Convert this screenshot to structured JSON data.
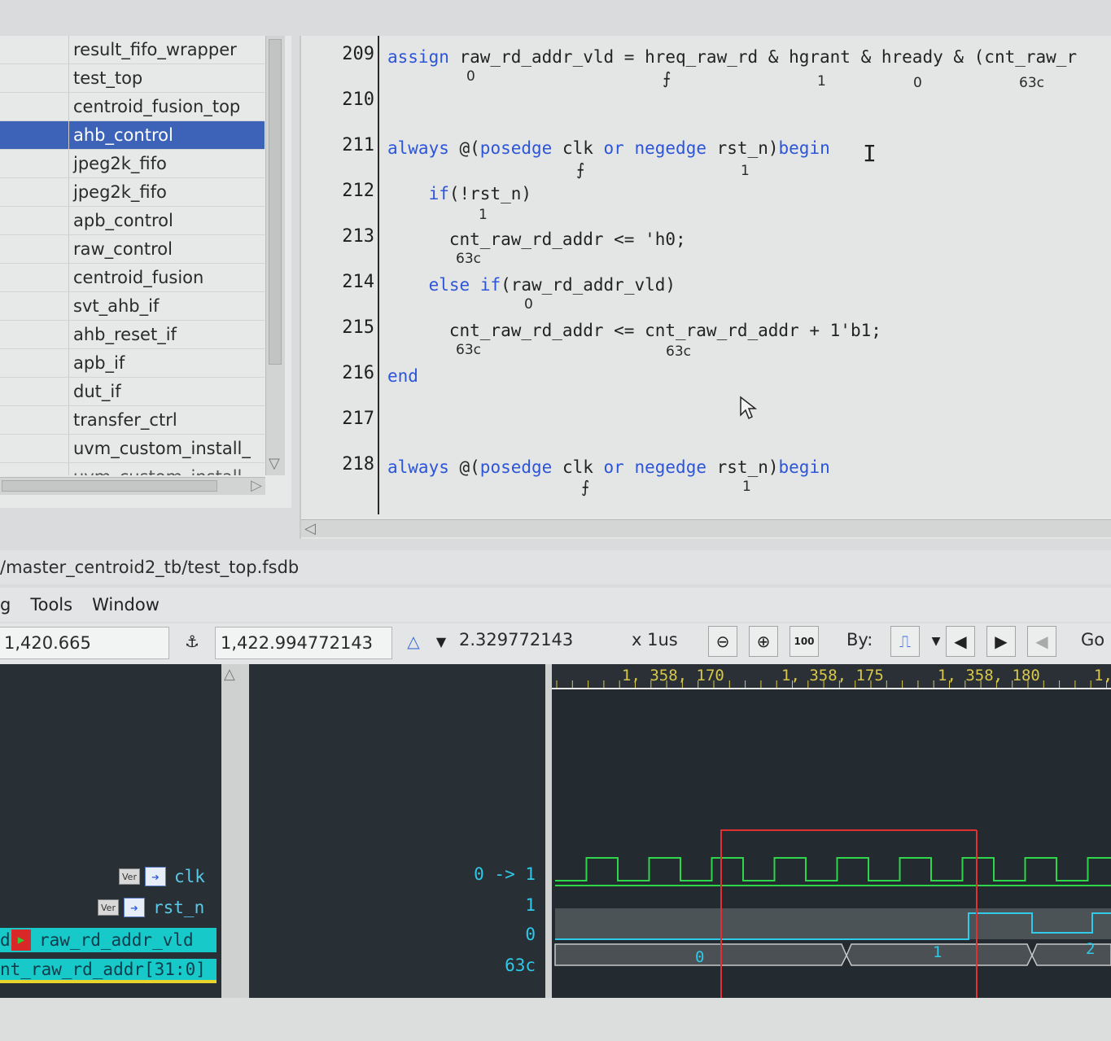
{
  "hierarchy": {
    "items": [
      {
        "label": "result_fifo_wrapper",
        "selected": false
      },
      {
        "label": "test_top",
        "selected": false
      },
      {
        "label": "centroid_fusion_top",
        "selected": false
      },
      {
        "label": "ahb_control",
        "selected": true
      },
      {
        "label": "jpeg2k_fifo",
        "selected": false
      },
      {
        "label": "jpeg2k_fifo",
        "selected": false
      },
      {
        "label": "apb_control",
        "selected": false
      },
      {
        "label": "raw_control",
        "selected": false
      },
      {
        "label": "centroid_fusion",
        "selected": false
      },
      {
        "label": "svt_ahb_if",
        "selected": false
      },
      {
        "label": "ahb_reset_if",
        "selected": false
      },
      {
        "label": "apb_if",
        "selected": false
      },
      {
        "label": "dut_if",
        "selected": false
      },
      {
        "label": "transfer_ctrl",
        "selected": false
      },
      {
        "label": "uvm_custom_install_",
        "selected": false
      },
      {
        "label": "uvm_custom_install",
        "selected": false
      }
    ]
  },
  "source": {
    "lines": [
      {
        "num": "209",
        "text": "assign raw_rd_addr_vld = hreq_raw_rd & hgrant & hready & (cnt_raw_r"
      },
      {
        "num": "210",
        "text": ""
      },
      {
        "num": "211",
        "text": "always @(posedge clk or negedge rst_n)begin"
      },
      {
        "num": "212",
        "text": "    if(!rst_n)"
      },
      {
        "num": "213",
        "text": "      cnt_raw_rd_addr <= 'h0;"
      },
      {
        "num": "214",
        "text": "    else if(raw_rd_addr_vld)"
      },
      {
        "num": "215",
        "text": "      cnt_raw_rd_addr <= cnt_raw_rd_addr + 1'b1;"
      },
      {
        "num": "216",
        "text": "end"
      },
      {
        "num": "217",
        "text": ""
      },
      {
        "num": "218",
        "text": "always @(posedge clk or negedge rst_n)begin"
      }
    ],
    "annotations": {
      "a209_vld": "0",
      "a209_hgrant": "1",
      "a209_hready": "0",
      "a209_cnt": "63c",
      "a211_rst": "1",
      "a212_rst": "1",
      "a213_cnt": "63c",
      "a214_vld": "0",
      "a215_cnt_l": "63c",
      "a215_cnt_r": "63c",
      "a218_rst": "1"
    },
    "text_cursor": "I"
  },
  "nwave": {
    "title": "/master_centroid2_tb/test_top.fsdb",
    "menu": [
      "g",
      "Tools",
      "Window"
    ],
    "toolbar": {
      "cursor_time": "1,420.665",
      "marker_time": "1,422.994772143",
      "delta": "2.329772143",
      "unit": "x 1us",
      "by_label": "By:",
      "go_label": "Go",
      "zoom_100": "100"
    },
    "ruler": [
      "1, 358, 170",
      "1, 358, 175",
      "1, 358, 180",
      "1,"
    ],
    "signals": [
      {
        "name": "clk",
        "value": "0 -> 1",
        "badge": "Ver"
      },
      {
        "name": "rst_n",
        "value": "1",
        "badge": "Ver"
      },
      {
        "name": "raw_rd_addr_vld",
        "value": "0",
        "badge": "d"
      },
      {
        "name": "nt_raw_rd_addr[31:0]",
        "value": "63c",
        "badge": ""
      }
    ],
    "bus_values": [
      "0",
      "1",
      "2"
    ]
  }
}
